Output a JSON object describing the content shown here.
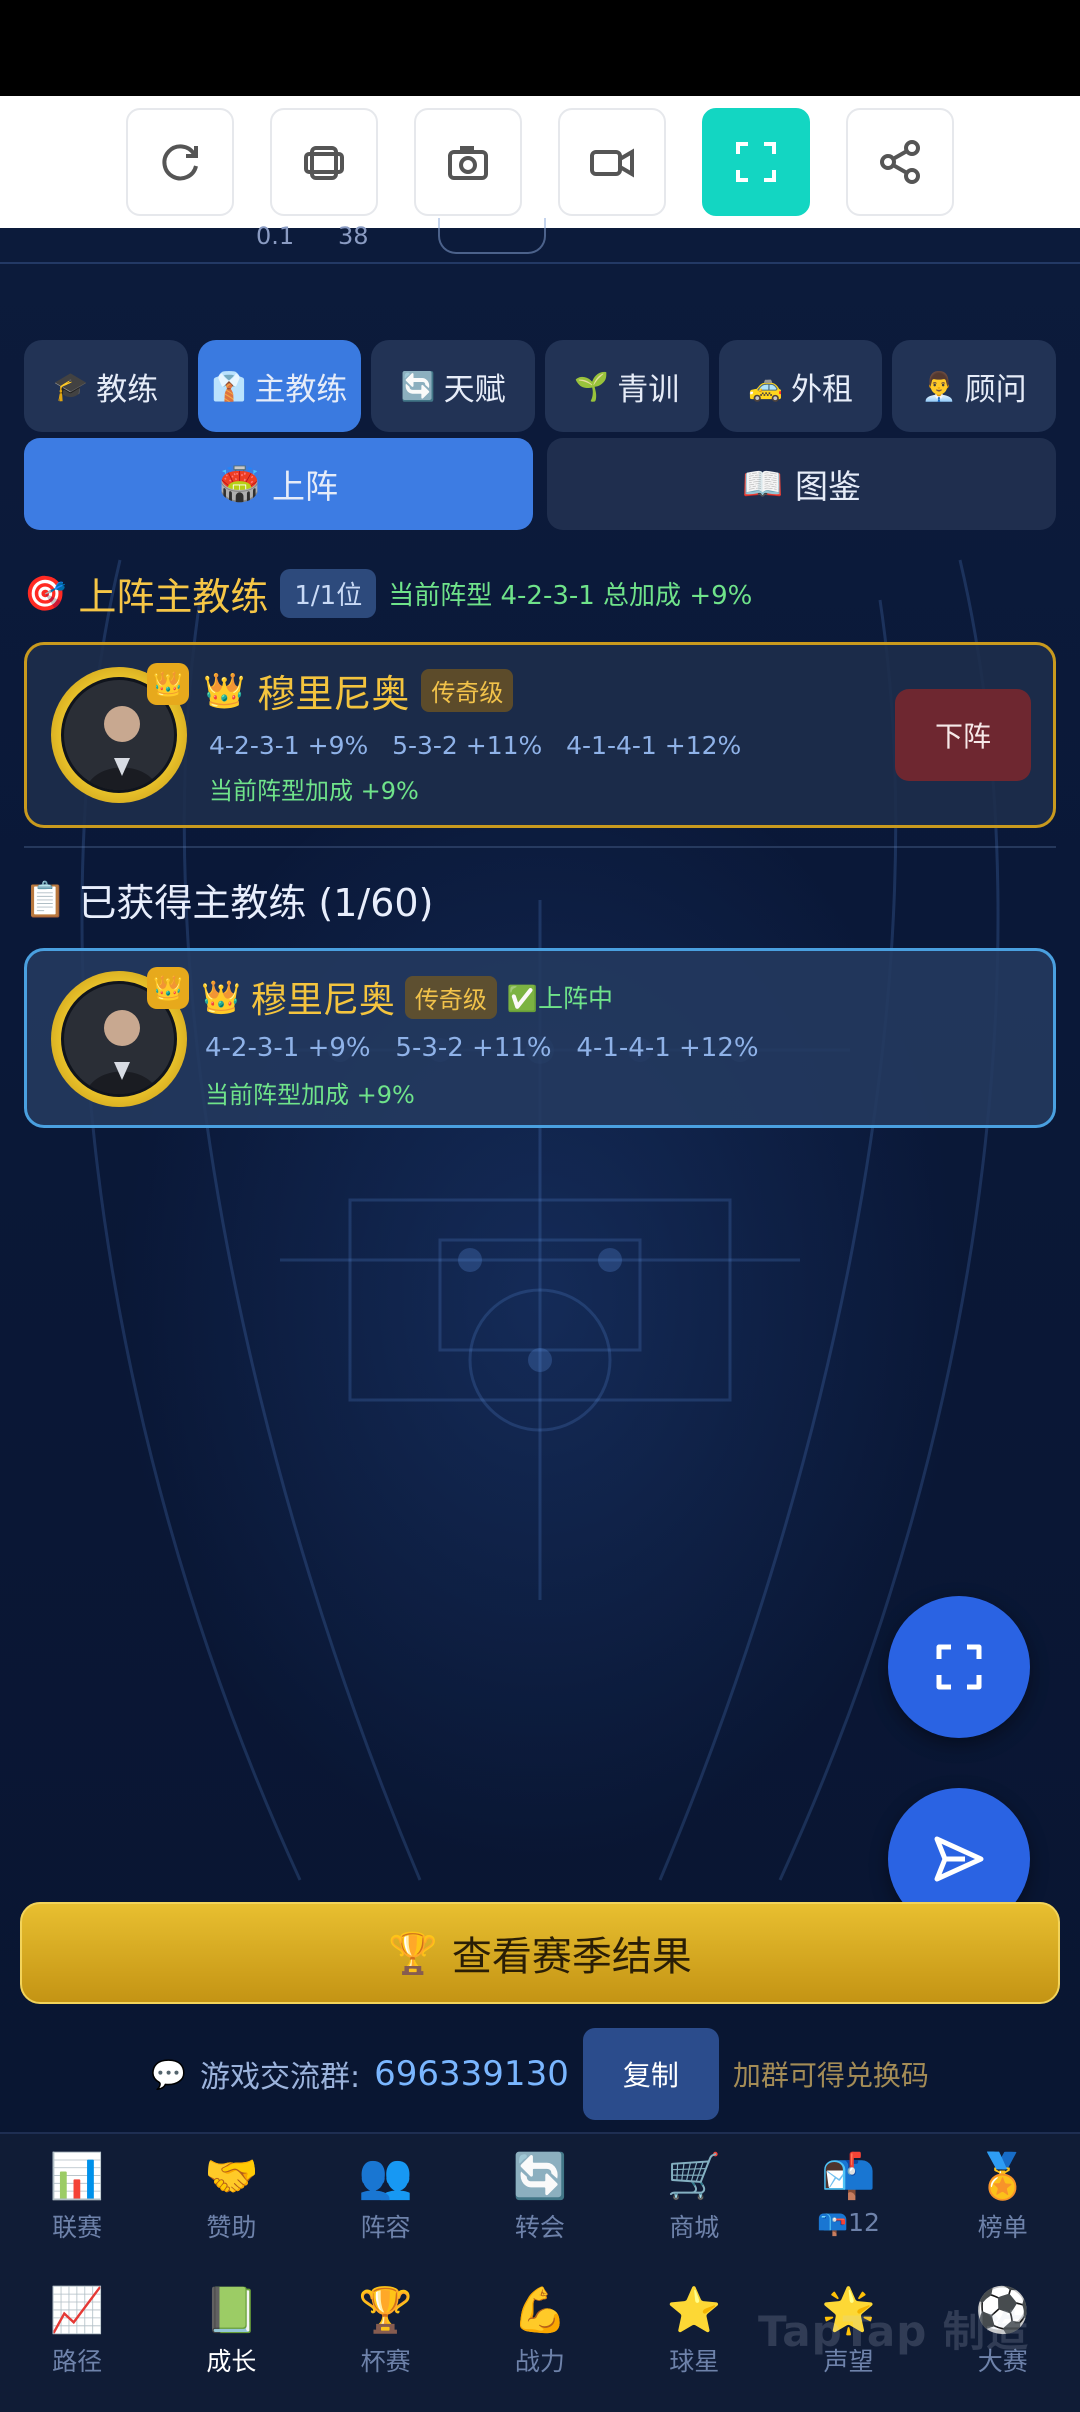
{
  "toolbar": {
    "buttons": [
      {
        "icon": "refresh-icon"
      },
      {
        "icon": "layers-icon"
      },
      {
        "icon": "camera-icon"
      },
      {
        "icon": "video-icon"
      },
      {
        "icon": "fullscreen-icon",
        "active": true
      },
      {
        "icon": "share-icon"
      }
    ]
  },
  "scrap": {
    "val1": "0.1",
    "val2": "38"
  },
  "tabs": [
    {
      "icon": "🎓",
      "label": "教练"
    },
    {
      "icon": "👔",
      "label": "主教练"
    },
    {
      "icon": "🔄",
      "label": "天赋"
    },
    {
      "icon": "🌱",
      "label": "青训"
    },
    {
      "icon": "🚕",
      "label": "外租"
    },
    {
      "icon": "👨‍💼",
      "label": "顾问"
    }
  ],
  "subtabs": [
    {
      "icon": "🏟️",
      "label": "上阵"
    },
    {
      "icon": "📖",
      "label": "图鉴"
    }
  ],
  "lineup": {
    "icon": "🎯",
    "title": "上阵主教练",
    "slots": "1/1位",
    "info": "当前阵型 4-2-3-1 总加成 +9%",
    "coach": {
      "crown": "👑",
      "name": "穆里尼奥",
      "rarity": "传奇级",
      "formations": "4-2-3-1 +9%   5-3-2 +11%   4-1-4-1 +12%",
      "bonus": "当前阵型加成 +9%",
      "button": "下阵"
    }
  },
  "owned": {
    "icon": "📋",
    "title": "已获得主教练 (1/60)",
    "coach": {
      "crown": "👑",
      "name": "穆里尼奥",
      "rarity": "传奇级",
      "status": "✅上阵中",
      "formations": "4-2-3-1 +9%   5-3-2 +11%   4-1-4-1 +12%",
      "bonus": "当前阵型加成 +9%"
    }
  },
  "season_button": {
    "icon": "🏆",
    "label": "查看赛季结果"
  },
  "group": {
    "icon": "💬",
    "label": "游戏交流群:",
    "number": "696339130",
    "copy": "复制",
    "hint": "加群可得兑换码"
  },
  "nav": {
    "row1": [
      {
        "icon": "📊",
        "label": "联赛"
      },
      {
        "icon": "🤝",
        "label": "赞助"
      },
      {
        "icon": "👥",
        "label": "阵容"
      },
      {
        "icon": "🔄",
        "label": "转会"
      },
      {
        "icon": "🛒",
        "label": "商城"
      },
      {
        "icon": "📬",
        "label": "📪12"
      },
      {
        "icon": "🏅",
        "label": "榜单"
      }
    ],
    "row2": [
      {
        "icon": "📈",
        "label": "路径"
      },
      {
        "icon": "📗",
        "label": "成长",
        "active": true
      },
      {
        "icon": "🏆",
        "label": "杯赛"
      },
      {
        "icon": "💪",
        "label": "战力"
      },
      {
        "icon": "⭐",
        "label": "球星"
      },
      {
        "icon": "🌟",
        "label": "声望"
      },
      {
        "icon": "⚽",
        "label": "大赛"
      }
    ]
  },
  "watermark": "TapTap 制造"
}
